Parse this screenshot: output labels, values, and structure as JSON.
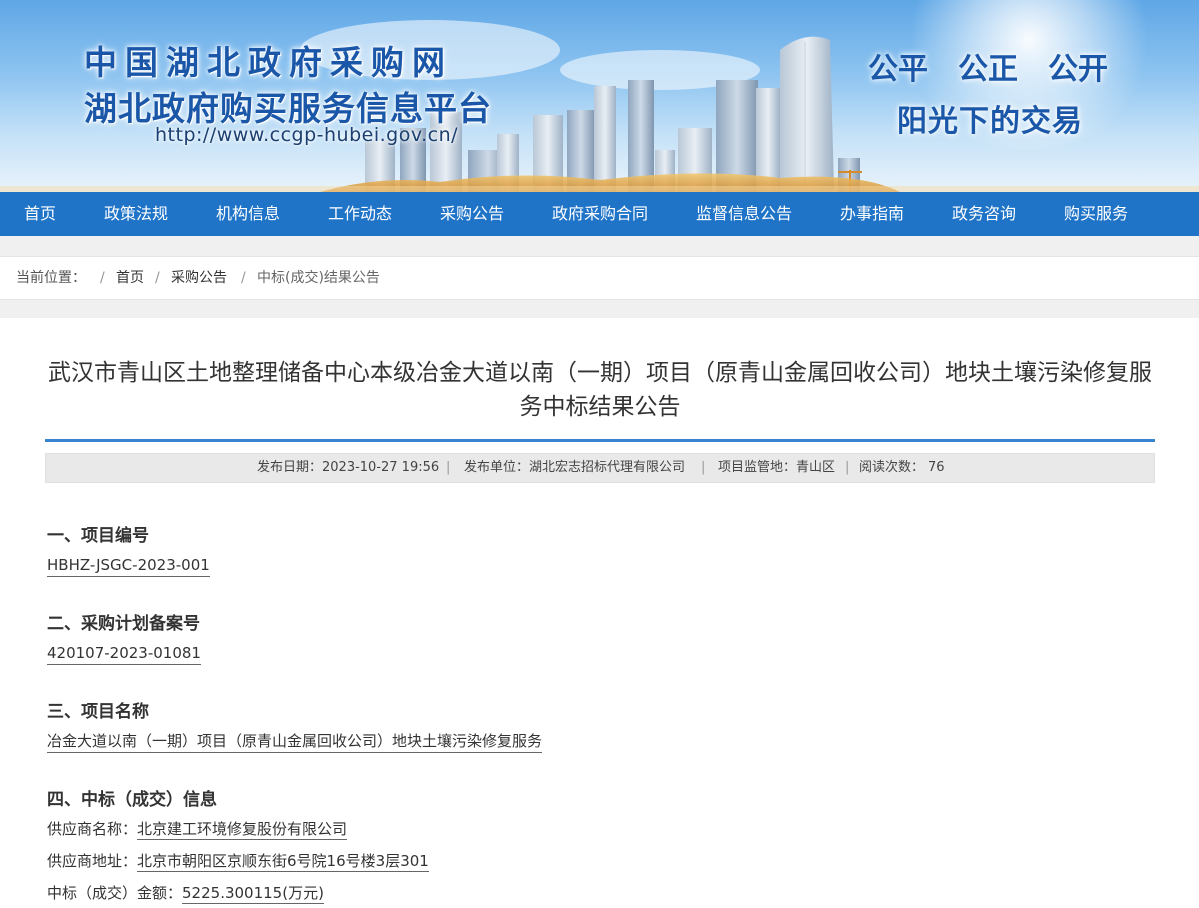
{
  "header": {
    "site_title": "中国湖北政府采购网",
    "site_subtitle": "湖北政府购买服务信息平台",
    "url": "http://www.ccgp-hubei.gov.cn/",
    "slogan_line1": "公平　公正　公开",
    "slogan_line2": "阳光下的交易"
  },
  "nav": {
    "items": [
      {
        "label": "首页"
      },
      {
        "label": "政策法规"
      },
      {
        "label": "机构信息"
      },
      {
        "label": "工作动态"
      },
      {
        "label": "采购公告"
      },
      {
        "label": "政府采购合同"
      },
      {
        "label": "监督信息公告"
      },
      {
        "label": "办事指南"
      },
      {
        "label": "政务咨询"
      },
      {
        "label": "购买服务"
      }
    ]
  },
  "breadcrumb": {
    "prefix": "当前位置：",
    "separator": "/",
    "items": [
      {
        "label": "首页"
      },
      {
        "label": "采购公告"
      },
      {
        "label": "中标(成交)结果公告"
      }
    ]
  },
  "article": {
    "title": "武汉市青山区土地整理储备中心本级冶金大道以南（一期）项目（原青山金属回收公司）地块土壤污染修复服务中标结果公告",
    "meta": {
      "publish_date_label": "发布日期：",
      "publish_date": "2023-10-27 19:56",
      "publisher_label": "发布单位：",
      "publisher": "湖北宏志招标代理有限公司",
      "region_label": "项目监管地：",
      "region": "青山区",
      "views_label": "阅读次数：",
      "views": "76",
      "separator": "|"
    },
    "sections": {
      "s1_heading": "一、项目编号",
      "s1_value": "HBHZ-JSGC-2023-001",
      "s2_heading": "二、采购计划备案号",
      "s2_value": "420107-2023-01081",
      "s3_heading": "三、项目名称",
      "s3_value": "冶金大道以南（一期）项目（原青山金属回收公司）地块土壤污染修复服务",
      "s4_heading": "四、中标（成交）信息",
      "supplier_name_label": "供应商名称：",
      "supplier_name": "北京建工环境修复股份有限公司",
      "supplier_address_label": "供应商地址：",
      "supplier_address": "北京市朝阳区京顺东街6号院16号楼3层301",
      "amount_label": "中标（成交）金额：",
      "amount": "5225.300115(万元)"
    }
  }
}
